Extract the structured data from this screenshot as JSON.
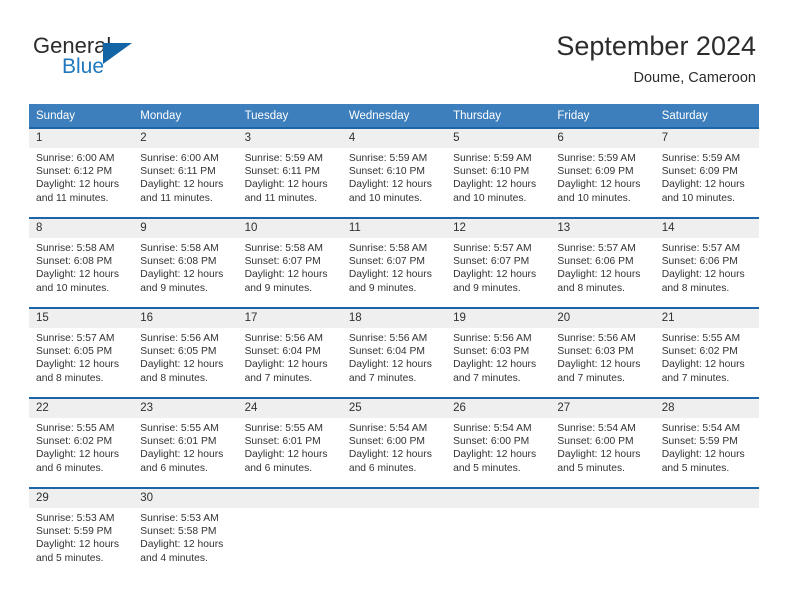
{
  "brand": {
    "name_part1": "General",
    "name_part2": "Blue",
    "accent_color": "#1364a5",
    "blue_text_color": "#1f78bd",
    "triangle_icon": "triangle-icon"
  },
  "header": {
    "title": "September 2024",
    "subtitle": "Doume, Cameroon"
  },
  "calendar": {
    "header_bg": "#3d7ebc",
    "row_divider_color": "#1c65a8",
    "day_strip_bg": "#efefef",
    "weekdays": [
      "Sunday",
      "Monday",
      "Tuesday",
      "Wednesday",
      "Thursday",
      "Friday",
      "Saturday"
    ],
    "weeks": [
      [
        {
          "date": "1",
          "sunrise": "Sunrise: 6:00 AM",
          "sunset": "Sunset: 6:12 PM",
          "daylight_1": "Daylight: 12 hours",
          "daylight_2": "and 11 minutes."
        },
        {
          "date": "2",
          "sunrise": "Sunrise: 6:00 AM",
          "sunset": "Sunset: 6:11 PM",
          "daylight_1": "Daylight: 12 hours",
          "daylight_2": "and 11 minutes."
        },
        {
          "date": "3",
          "sunrise": "Sunrise: 5:59 AM",
          "sunset": "Sunset: 6:11 PM",
          "daylight_1": "Daylight: 12 hours",
          "daylight_2": "and 11 minutes."
        },
        {
          "date": "4",
          "sunrise": "Sunrise: 5:59 AM",
          "sunset": "Sunset: 6:10 PM",
          "daylight_1": "Daylight: 12 hours",
          "daylight_2": "and 10 minutes."
        },
        {
          "date": "5",
          "sunrise": "Sunrise: 5:59 AM",
          "sunset": "Sunset: 6:10 PM",
          "daylight_1": "Daylight: 12 hours",
          "daylight_2": "and 10 minutes."
        },
        {
          "date": "6",
          "sunrise": "Sunrise: 5:59 AM",
          "sunset": "Sunset: 6:09 PM",
          "daylight_1": "Daylight: 12 hours",
          "daylight_2": "and 10 minutes."
        },
        {
          "date": "7",
          "sunrise": "Sunrise: 5:59 AM",
          "sunset": "Sunset: 6:09 PM",
          "daylight_1": "Daylight: 12 hours",
          "daylight_2": "and 10 minutes."
        }
      ],
      [
        {
          "date": "8",
          "sunrise": "Sunrise: 5:58 AM",
          "sunset": "Sunset: 6:08 PM",
          "daylight_1": "Daylight: 12 hours",
          "daylight_2": "and 10 minutes."
        },
        {
          "date": "9",
          "sunrise": "Sunrise: 5:58 AM",
          "sunset": "Sunset: 6:08 PM",
          "daylight_1": "Daylight: 12 hours",
          "daylight_2": "and 9 minutes."
        },
        {
          "date": "10",
          "sunrise": "Sunrise: 5:58 AM",
          "sunset": "Sunset: 6:07 PM",
          "daylight_1": "Daylight: 12 hours",
          "daylight_2": "and 9 minutes."
        },
        {
          "date": "11",
          "sunrise": "Sunrise: 5:58 AM",
          "sunset": "Sunset: 6:07 PM",
          "daylight_1": "Daylight: 12 hours",
          "daylight_2": "and 9 minutes."
        },
        {
          "date": "12",
          "sunrise": "Sunrise: 5:57 AM",
          "sunset": "Sunset: 6:07 PM",
          "daylight_1": "Daylight: 12 hours",
          "daylight_2": "and 9 minutes."
        },
        {
          "date": "13",
          "sunrise": "Sunrise: 5:57 AM",
          "sunset": "Sunset: 6:06 PM",
          "daylight_1": "Daylight: 12 hours",
          "daylight_2": "and 8 minutes."
        },
        {
          "date": "14",
          "sunrise": "Sunrise: 5:57 AM",
          "sunset": "Sunset: 6:06 PM",
          "daylight_1": "Daylight: 12 hours",
          "daylight_2": "and 8 minutes."
        }
      ],
      [
        {
          "date": "15",
          "sunrise": "Sunrise: 5:57 AM",
          "sunset": "Sunset: 6:05 PM",
          "daylight_1": "Daylight: 12 hours",
          "daylight_2": "and 8 minutes."
        },
        {
          "date": "16",
          "sunrise": "Sunrise: 5:56 AM",
          "sunset": "Sunset: 6:05 PM",
          "daylight_1": "Daylight: 12 hours",
          "daylight_2": "and 8 minutes."
        },
        {
          "date": "17",
          "sunrise": "Sunrise: 5:56 AM",
          "sunset": "Sunset: 6:04 PM",
          "daylight_1": "Daylight: 12 hours",
          "daylight_2": "and 7 minutes."
        },
        {
          "date": "18",
          "sunrise": "Sunrise: 5:56 AM",
          "sunset": "Sunset: 6:04 PM",
          "daylight_1": "Daylight: 12 hours",
          "daylight_2": "and 7 minutes."
        },
        {
          "date": "19",
          "sunrise": "Sunrise: 5:56 AM",
          "sunset": "Sunset: 6:03 PM",
          "daylight_1": "Daylight: 12 hours",
          "daylight_2": "and 7 minutes."
        },
        {
          "date": "20",
          "sunrise": "Sunrise: 5:56 AM",
          "sunset": "Sunset: 6:03 PM",
          "daylight_1": "Daylight: 12 hours",
          "daylight_2": "and 7 minutes."
        },
        {
          "date": "21",
          "sunrise": "Sunrise: 5:55 AM",
          "sunset": "Sunset: 6:02 PM",
          "daylight_1": "Daylight: 12 hours",
          "daylight_2": "and 7 minutes."
        }
      ],
      [
        {
          "date": "22",
          "sunrise": "Sunrise: 5:55 AM",
          "sunset": "Sunset: 6:02 PM",
          "daylight_1": "Daylight: 12 hours",
          "daylight_2": "and 6 minutes."
        },
        {
          "date": "23",
          "sunrise": "Sunrise: 5:55 AM",
          "sunset": "Sunset: 6:01 PM",
          "daylight_1": "Daylight: 12 hours",
          "daylight_2": "and 6 minutes."
        },
        {
          "date": "24",
          "sunrise": "Sunrise: 5:55 AM",
          "sunset": "Sunset: 6:01 PM",
          "daylight_1": "Daylight: 12 hours",
          "daylight_2": "and 6 minutes."
        },
        {
          "date": "25",
          "sunrise": "Sunrise: 5:54 AM",
          "sunset": "Sunset: 6:00 PM",
          "daylight_1": "Daylight: 12 hours",
          "daylight_2": "and 6 minutes."
        },
        {
          "date": "26",
          "sunrise": "Sunrise: 5:54 AM",
          "sunset": "Sunset: 6:00 PM",
          "daylight_1": "Daylight: 12 hours",
          "daylight_2": "and 5 minutes."
        },
        {
          "date": "27",
          "sunrise": "Sunrise: 5:54 AM",
          "sunset": "Sunset: 6:00 PM",
          "daylight_1": "Daylight: 12 hours",
          "daylight_2": "and 5 minutes."
        },
        {
          "date": "28",
          "sunrise": "Sunrise: 5:54 AM",
          "sunset": "Sunset: 5:59 PM",
          "daylight_1": "Daylight: 12 hours",
          "daylight_2": "and 5 minutes."
        }
      ],
      [
        {
          "date": "29",
          "sunrise": "Sunrise: 5:53 AM",
          "sunset": "Sunset: 5:59 PM",
          "daylight_1": "Daylight: 12 hours",
          "daylight_2": "and 5 minutes."
        },
        {
          "date": "30",
          "sunrise": "Sunrise: 5:53 AM",
          "sunset": "Sunset: 5:58 PM",
          "daylight_1": "Daylight: 12 hours",
          "daylight_2": "and 4 minutes."
        },
        {
          "date": "",
          "sunrise": "",
          "sunset": "",
          "daylight_1": "",
          "daylight_2": ""
        },
        {
          "date": "",
          "sunrise": "",
          "sunset": "",
          "daylight_1": "",
          "daylight_2": ""
        },
        {
          "date": "",
          "sunrise": "",
          "sunset": "",
          "daylight_1": "",
          "daylight_2": ""
        },
        {
          "date": "",
          "sunrise": "",
          "sunset": "",
          "daylight_1": "",
          "daylight_2": ""
        },
        {
          "date": "",
          "sunrise": "",
          "sunset": "",
          "daylight_1": "",
          "daylight_2": ""
        }
      ]
    ]
  }
}
